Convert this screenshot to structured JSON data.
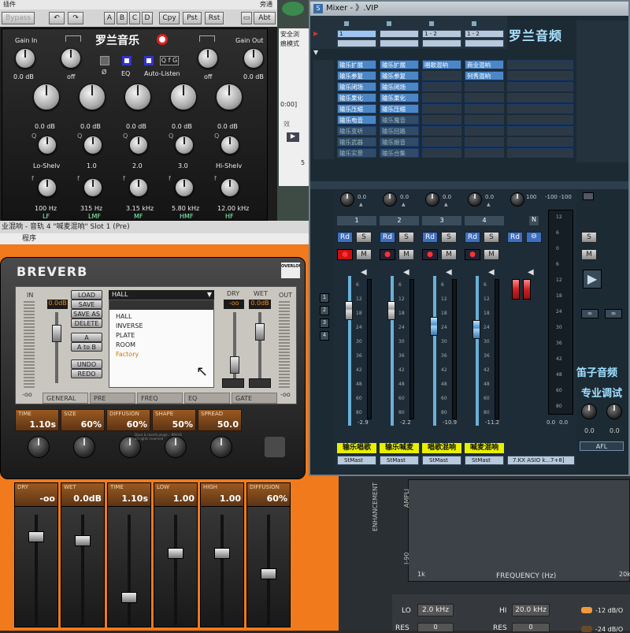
{
  "eq_window": {
    "menu": "插件",
    "menu_right": "旁通",
    "bypass": "Bypass",
    "toolbar": [
      "A",
      "B",
      "C",
      "D"
    ],
    "cpy": "Cpy",
    "pst": "Pst",
    "rst": "Rst",
    "abt": "Abt",
    "gain_in": "Gain In",
    "gain_out": "Gain Out",
    "gain_in_val": "0.0 dB",
    "gain_out_val": "0.0 dB",
    "off1": "off",
    "off2": "off",
    "brand": "罗兰音乐",
    "eq_label": "EQ",
    "autolisten": "Auto-Listen",
    "qfg": "Q f G",
    "phase": "Ø",
    "bands": [
      {
        "gain": "0.0 dB",
        "shape": "Lo-Shelv",
        "freq": "100 Hz",
        "tag": "LF"
      },
      {
        "gain": "0.0 dB",
        "shape": "1.0",
        "freq": "315 Hz",
        "tag": "LMF"
      },
      {
        "gain": "0.0 dB",
        "shape": "2.0",
        "freq": "3.15 kHz",
        "tag": "MF"
      },
      {
        "gain": "0.0 dB",
        "shape": "3.0",
        "freq": "5.80 kHz",
        "tag": "HMF"
      },
      {
        "gain": "0.0 dB",
        "shape": "Hi-Shelv",
        "freq": "12.00 kHz",
        "tag": "HF"
      }
    ]
  },
  "left_mid": {
    "side_labels": [
      "安全浏",
      "痕模式",
      "0:00]",
      "效",
      "5"
    ],
    "title": "业混响 - 音轨 4 \"喊麦混响\" Slot 1 (Pre)",
    "menu": "程序"
  },
  "reverb": {
    "logo": "BREVERB",
    "badge": "OVERLOUD",
    "in": "IN",
    "out": "OUT",
    "in_val": "0.0dB",
    "dry": "DRY",
    "wet": "WET",
    "dry_val": "-oo",
    "wet_val": "0.0dB",
    "preset": "HALL",
    "buttons": [
      "LOAD",
      "SAVE",
      "SAVE AS",
      "DELETE",
      "A",
      "A to B",
      "UNDO",
      "REDO"
    ],
    "list": [
      "HALL",
      "INVERSE",
      "PLATE",
      "ROOM",
      "Factory"
    ],
    "tabs": [
      "GENERAL",
      "PRE",
      "FREQ",
      "EQ",
      "GATE"
    ],
    "params": [
      {
        "label": "TIME",
        "value": "1.10s"
      },
      {
        "label": "SIZE",
        "value": "60%"
      },
      {
        "label": "DIFFUSION",
        "value": "60%"
      },
      {
        "label": "SHAPE",
        "value": "50%"
      },
      {
        "label": "SPREAD",
        "value": "50.0"
      }
    ],
    "inf1": "-oo",
    "inf2": "-oo",
    "footnote": "Dave & reverb plugin - BREVERB\nall rights reserved",
    "faders": [
      {
        "label": "DRY",
        "value": "-oo"
      },
      {
        "label": "WET",
        "value": "0.0dB"
      },
      {
        "label": "TIME",
        "value": "1.10s"
      },
      {
        "label": "LOW",
        "value": "1.00"
      },
      {
        "label": "HIGH",
        "value": "1.00"
      },
      {
        "label": "DIFFUSION",
        "value": "60%"
      }
    ]
  },
  "mixer": {
    "title": "Mixer - 》.VIP",
    "brand": "罗兰音频",
    "io": [
      "1",
      "",
      "1 - 2",
      "1 - 2"
    ],
    "col1": [
      "输乐扩展",
      "输乐参复",
      "输乐闭场",
      "输乐果化",
      "输乐压缩",
      "输乐电音",
      "输乐变听",
      "输乐武器",
      "输乐实景"
    ],
    "col2": [
      "输乐扩展",
      "输乐参复",
      "输乐闭场",
      "输乐果化",
      "输乐压缩",
      "输乐魔音",
      "输乐回路",
      "输乐娘音",
      "输乐合集"
    ],
    "col3": [
      "唱歌混响"
    ],
    "col4": [
      "商业混响",
      "列秀混响"
    ],
    "pans": [
      "0.0",
      "0.0",
      "0.0",
      "0.0"
    ],
    "pan_extra": "100",
    "meter_top": [
      "-100",
      "-100"
    ],
    "chan_nums": [
      "1",
      "2",
      "3",
      "4",
      "N"
    ],
    "rd": "Rd",
    "s": "S",
    "m": "M",
    "scale": [
      "6",
      "12",
      "18",
      "24",
      "30",
      "36",
      "42",
      "48",
      "60",
      "80"
    ],
    "readouts": [
      "-2.9",
      "-2.2",
      "-10.9",
      "-11.2",
      "0.0",
      "0.0",
      "0.0"
    ],
    "right_scale": [
      "12",
      "6",
      "0",
      "6",
      "12",
      "18",
      "24",
      "30",
      "36",
      "42",
      "48",
      "60",
      "80"
    ],
    "names": [
      "输乐唱歌",
      "输乐喊麦",
      "唱歌混响",
      "喊麦混响"
    ],
    "outs": [
      "StMast",
      "StMast",
      "StMast",
      "StMast",
      "7.KX ASIO k...7+8]"
    ],
    "promo": [
      "笛子音频",
      "专业调试"
    ],
    "knob_vals": [
      "0.0",
      "0.0"
    ],
    "afl": "AFL"
  },
  "bottom_right": {
    "amp": "AMPLI",
    "enh": "ENHANCEMENT",
    "freq": "FREQUENCY (Hz)",
    "k1": "1k",
    "k20": "20k",
    "minus90": "I-90",
    "lo": "LO",
    "lo_val": "2.0 kHz",
    "hi": "HI",
    "hi_val": "20.0 kHz",
    "db1": "-12 dB/O",
    "res": "RES",
    "res_val": "0",
    "res2": "RES",
    "res2_val": "0",
    "db2": "-24 dB/O"
  }
}
